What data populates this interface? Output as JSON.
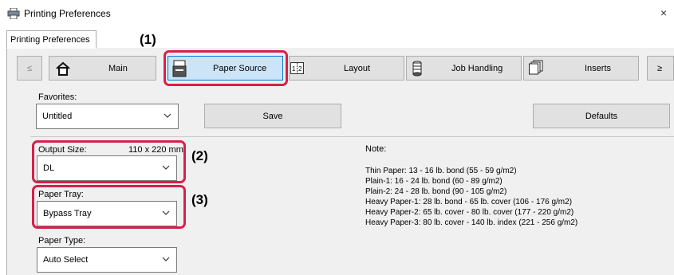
{
  "window": {
    "title": "Printing Preferences",
    "close": "×"
  },
  "tab": {
    "label": "Printing Preferences"
  },
  "nav": {
    "prev": "≤",
    "next": "≥",
    "main": "Main",
    "paper_source": "Paper Source",
    "layout": "Layout",
    "job_handling": "Job Handling",
    "inserts": "Inserts"
  },
  "favorites": {
    "label": "Favorites:",
    "value": "Untitled",
    "save": "Save",
    "defaults": "Defaults"
  },
  "output_size": {
    "label": "Output Size:",
    "dimensions": "110 x 220 mm",
    "value": "DL"
  },
  "paper_tray": {
    "label": "Paper Tray:",
    "value": "Bypass Tray"
  },
  "paper_type": {
    "label": "Paper Type:",
    "value": "Auto Select"
  },
  "note": {
    "label": "Note:",
    "lines": [
      "Thin Paper: 13 - 16 lb. bond (55 - 59 g/m2)",
      "Plain-1: 16 - 24 lb. bond (60 - 89 g/m2)",
      "Plain-2: 24 - 28 lb. bond (90 - 105 g/m2)",
      "Heavy Paper-1: 28 lb. bond - 65 lb. cover (106 - 176 g/m2)",
      "Heavy Paper-2: 65 lb. cover - 80 lb. cover (177 - 220 g/m2)",
      "Heavy Paper-3: 80 lb. cover - 140 lb. index (221 - 256 g/m2)"
    ]
  },
  "callouts": {
    "one": "(1)",
    "two": "(2)",
    "three": "(3)"
  },
  "colors": {
    "highlight": "#d6204b",
    "selected_bg": "#cce4f7",
    "panel_bg": "#f0f0f0"
  }
}
